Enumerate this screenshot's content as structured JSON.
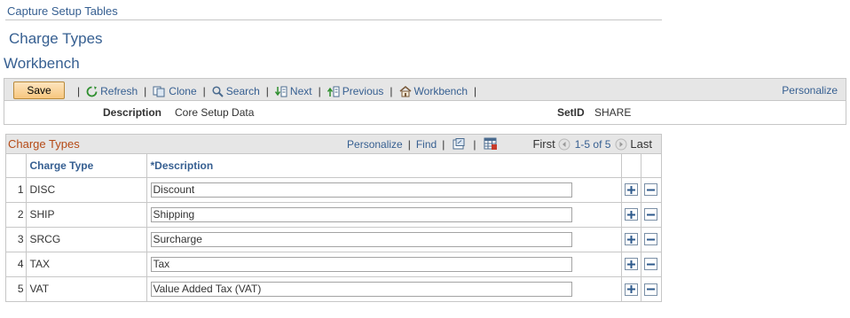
{
  "breadcrumb": "Capture Setup Tables",
  "page_title": "Charge Types",
  "section_title": "Workbench",
  "toolbar": {
    "save_label": "Save",
    "refresh_label": "Refresh",
    "clone_label": "Clone",
    "search_label": "Search",
    "next_label": "Next",
    "previous_label": "Previous",
    "workbench_label": "Workbench",
    "personalize_label": "Personalize"
  },
  "description_bar": {
    "description_label": "Description",
    "description_value": "Core Setup Data",
    "setid_label": "SetID",
    "setid_value": "SHARE"
  },
  "grid": {
    "title": "Charge Types",
    "personalize_label": "Personalize",
    "find_label": "Find",
    "first_label": "First",
    "range_label": "1-5 of 5",
    "last_label": "Last",
    "columns": [
      "Charge Type",
      "*Description"
    ],
    "rows": [
      {
        "num": "1",
        "code": "DISC",
        "description": "Discount"
      },
      {
        "num": "2",
        "code": "SHIP",
        "description": "Shipping"
      },
      {
        "num": "3",
        "code": "SRCG",
        "description": "Surcharge"
      },
      {
        "num": "4",
        "code": "TAX",
        "description": "Tax"
      },
      {
        "num": "5",
        "code": "VAT",
        "description": "Value Added Tax (VAT)"
      }
    ]
  },
  "colors": {
    "link": "#365f91",
    "grid_title": "#b54a16",
    "toolbar_bg": "#e6e6e6",
    "save_button": "#f7c77f"
  },
  "icons": [
    "refresh-icon",
    "clone-icon",
    "search-icon",
    "next-icon",
    "previous-icon",
    "workbench-icon",
    "view-all-icon",
    "download-icon",
    "prev-page-icon",
    "next-page-icon",
    "add-row-icon",
    "delete-row-icon"
  ]
}
